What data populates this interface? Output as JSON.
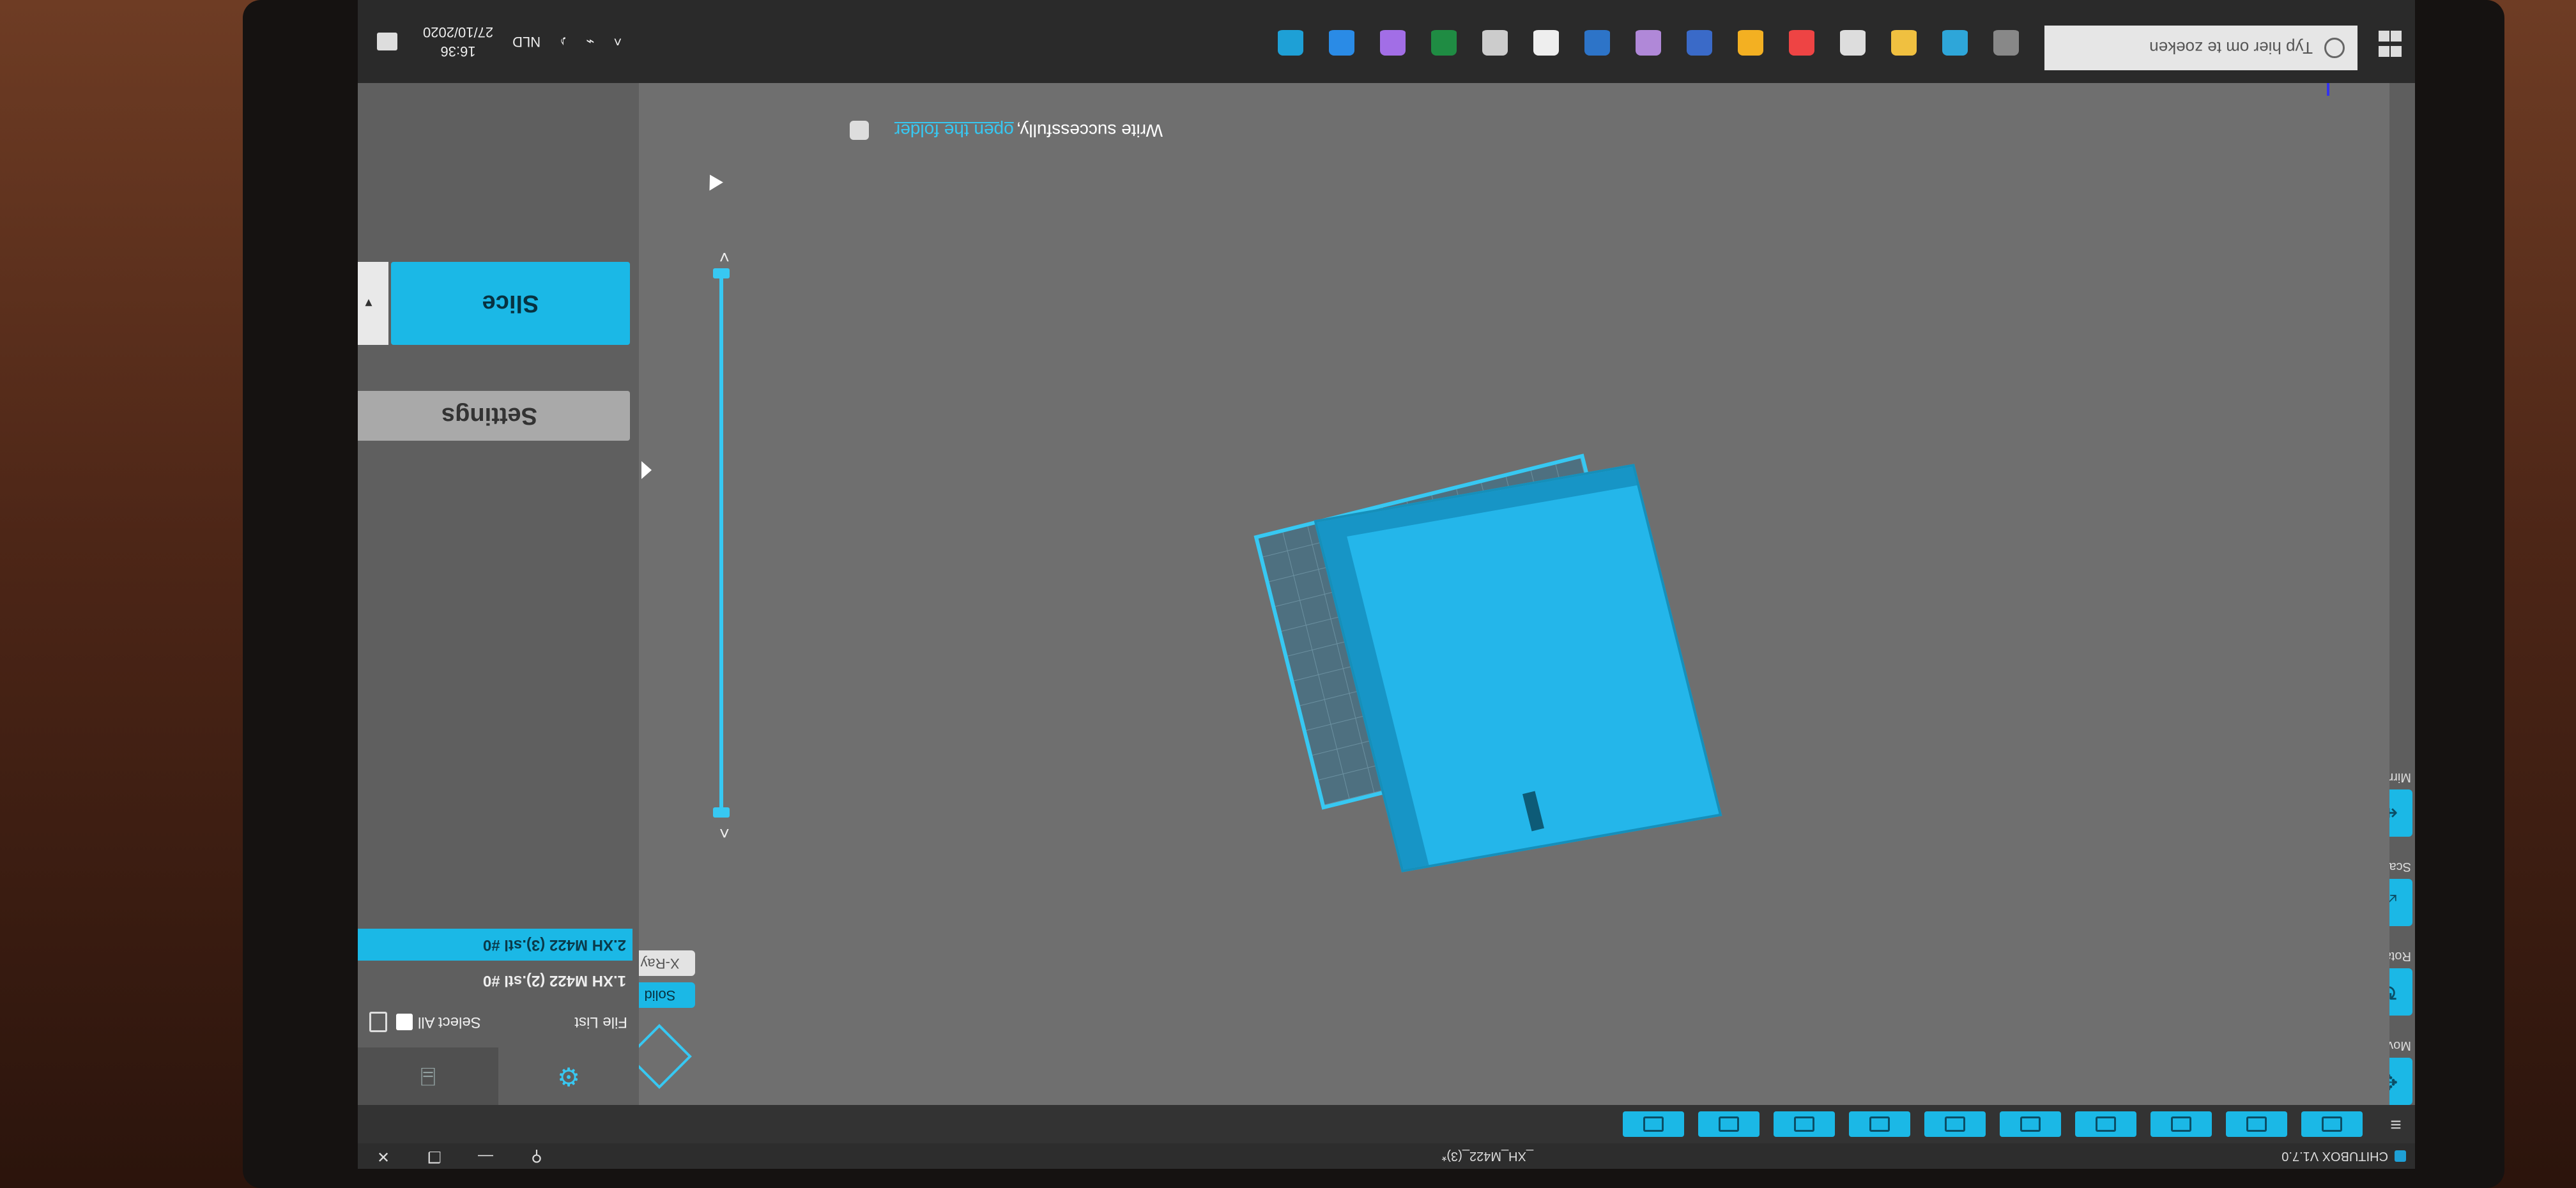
{
  "window": {
    "app_title": "CHITUBOX V1.7.0",
    "file_title": "_XH_M422_(3)*",
    "minimize": "—",
    "maximize": "❐",
    "close": "✕",
    "pin": "⚲"
  },
  "left_tools": {
    "move": "Move",
    "rotate": "Rotate",
    "scale": "Scale",
    "mirror": "Mirror"
  },
  "view_modes": {
    "solid": "Solid",
    "xray": "X-Ray"
  },
  "notification": {
    "message": "Write successfully,",
    "link": "open the folder"
  },
  "right_panel": {
    "file_list_label": "File List",
    "select_all_label": "Select All",
    "files": [
      {
        "name": "1.XH M422 (2).stl #0",
        "selected": false
      },
      {
        "name": "2.XH M422 (3).stl #0",
        "selected": true
      }
    ],
    "settings_label": "Settings",
    "slice_label": "Slice",
    "slice_dropdown": "▾"
  },
  "taskbar": {
    "search_placeholder": "Typ hier om te zoeken",
    "language": "NLD",
    "time": "16:36",
    "date": "27/10/2020"
  },
  "colors": {
    "accent": "#1bb8e6",
    "viewport": "#6f6f6f",
    "panel": "#5f5f5f"
  }
}
